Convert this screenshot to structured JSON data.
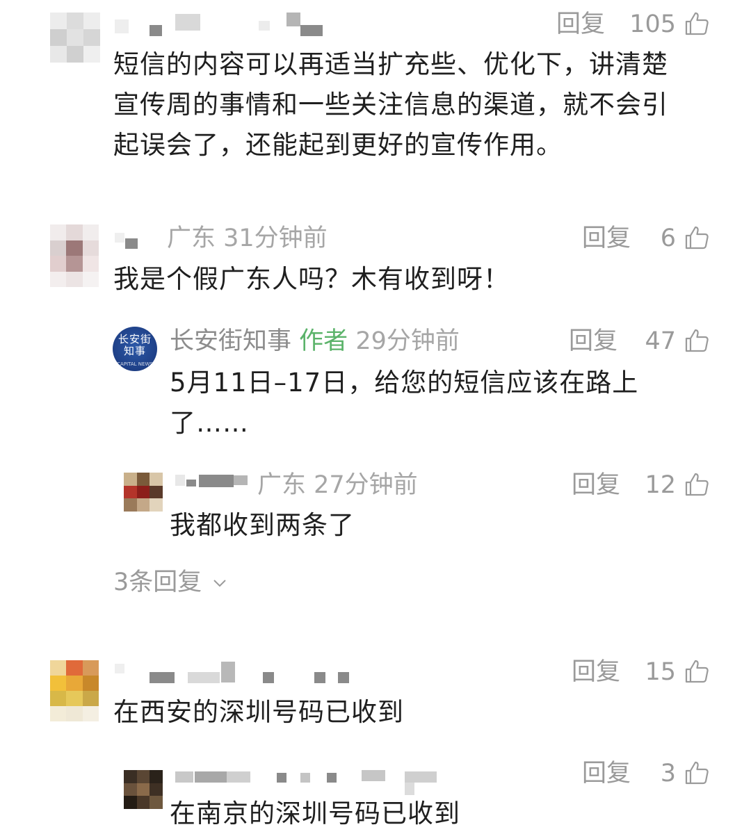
{
  "comments": [
    {
      "meta": "",
      "reply_label": "回复",
      "likes": "105",
      "text_lines": [
        "短信的内容可以再适当扩充些、优化下，讲清楚",
        "宣传周的事情和一些关注信息的渠道，就不会引",
        "起误会了，还能起到更好的宣传作用。"
      ]
    },
    {
      "meta": "广东 31分钟前",
      "reply_label": "回复",
      "likes": "6",
      "text_lines": [
        "我是个假广东人吗？木有收到呀！"
      ],
      "replies": [
        {
          "author_name": "长安街知事",
          "author_tag": "作者",
          "time": "29分钟前",
          "avatar_text": [
            "长安街",
            "知事",
            "CAPITAL NEWS"
          ],
          "reply_label": "回复",
          "likes": "47",
          "text_lines": [
            "5月11日–17日，给您的短信应该在路上",
            "了……"
          ]
        },
        {
          "meta": "广东 27分钟前",
          "reply_label": "回复",
          "likes": "12",
          "text_lines": [
            "我都收到两条了"
          ]
        }
      ],
      "more_replies": "3条回复"
    },
    {
      "reply_label": "回复",
      "likes": "15",
      "text_lines": [
        "在西安的深圳号码已收到"
      ],
      "replies": [
        {
          "reply_label": "回复",
          "likes": "3",
          "text_lines": [
            "在南京的深圳号码已收到"
          ]
        }
      ]
    }
  ],
  "colors": {
    "meta_gray": "#a6a6a6",
    "author_green": "#5bb36a",
    "body_text": "#1f1f1f",
    "author_avatar_blue": "#1e3f86"
  },
  "icons": {
    "like": "thumbs-up-icon",
    "expand": "chevron-down-icon"
  }
}
